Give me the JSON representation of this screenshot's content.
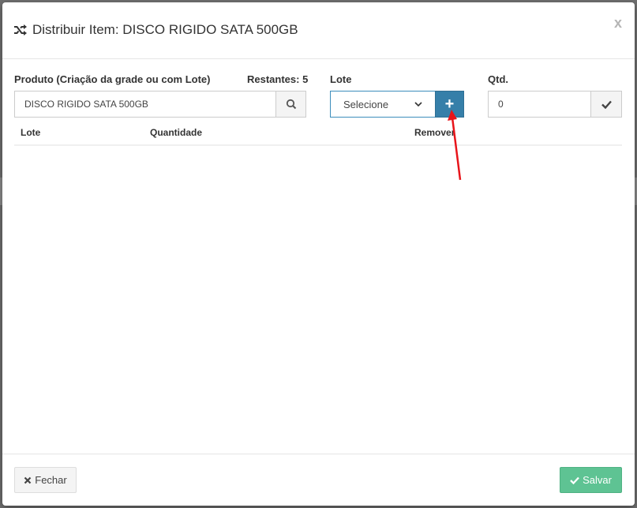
{
  "modal": {
    "title": "Distribuir Item: DISCO RIGIDO SATA 500GB",
    "close_label": "x"
  },
  "produto": {
    "label": "Produto (Criação da grade ou com Lote)",
    "restantes": "Restantes: 5",
    "value": "DISCO RIGIDO SATA 500GB"
  },
  "lote": {
    "label": "Lote",
    "selected": "Selecione",
    "add_label": "+"
  },
  "qtd": {
    "label": "Qtd.",
    "value": "0"
  },
  "table": {
    "headers": [
      "Lote",
      "Quantidade",
      "Remover"
    ]
  },
  "footer": {
    "close_label": "Fechar",
    "save_label": "Salvar"
  },
  "colors": {
    "primary": "#367fa9",
    "success": "#5ec393",
    "annotation": "#e8141a"
  }
}
